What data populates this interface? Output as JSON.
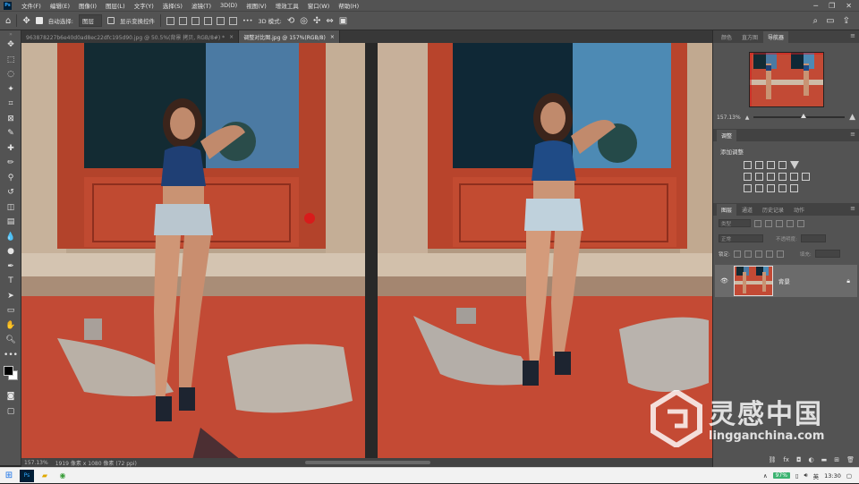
{
  "app": {
    "name": "Photoshop",
    "logo": "Ps"
  },
  "menubar": {
    "items": [
      "文件(F)",
      "编辑(E)",
      "图像(I)",
      "图层(L)",
      "文字(Y)",
      "选择(S)",
      "滤镜(T)",
      "3D(D)",
      "视图(V)",
      "增效工具",
      "窗口(W)",
      "帮助(H)"
    ]
  },
  "optionsbar": {
    "auto_select_label": "自动选择:",
    "auto_select_value": "图层",
    "show_transform_label": "显示变换控件",
    "more_label": "•••",
    "mode_3d_label": "3D 模式:"
  },
  "tabs": [
    {
      "label": "963878227b6e40d0ad8ec22dfc195d90.jpg @ 50.5%(背景 拷贝, RGB/8#) *"
    },
    {
      "label": "调整对比图.jpg @ 157%(RGB/8)"
    }
  ],
  "tab_close": "×",
  "statusbar": {
    "zoom": "157.13%",
    "doc_info": "1919 像素 x 1080 像素 (72 ppi)"
  },
  "panels": {
    "navigator_tabs": [
      "颜色",
      "直方图",
      "导航器"
    ],
    "navigator_zoom": "157.13%",
    "navigator_zoom_fraction": 0.52,
    "adjust_tab": "调整",
    "adjust_title": "添加调整",
    "layers_tabs": [
      "图层",
      "通道",
      "历史记录",
      "动作"
    ],
    "layers_filter": "类型",
    "blend_mode": "正常",
    "opacity_label": "不透明度:",
    "lock_label": "锁定:",
    "fill_label": "填充:",
    "layer_name": "背景"
  },
  "taskbar": {
    "battery": "97%",
    "ime": "英",
    "time": "13:30"
  },
  "watermark": {
    "cn": "灵感中国",
    "en": "lingganchina.com"
  },
  "colors": {
    "ui_bg": "#535353",
    "canvas_bg": "#282828",
    "wall_red": "#c24a35",
    "door_red": "#b8442c",
    "stone": "#c9b7a3",
    "sky": "#4b7aa3",
    "top_blue": "#1f3f74"
  }
}
